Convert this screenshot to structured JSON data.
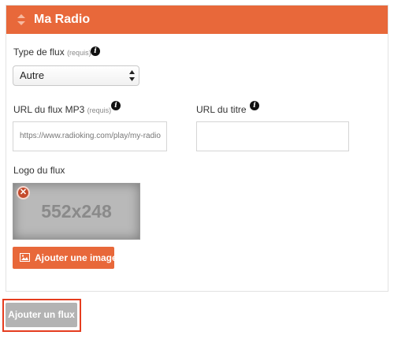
{
  "panel": {
    "title": "Ma Radio",
    "header_color": "#e8683a"
  },
  "stream_type": {
    "label": "Type de flux",
    "required": "(requis)",
    "selected": "Autre"
  },
  "mp3_url": {
    "label": "URL du flux MP3",
    "required": "(requis)",
    "value": "https://www.radioking.com/play/my-radio"
  },
  "title_url": {
    "label": "URL du titre",
    "value": ""
  },
  "logo": {
    "label": "Logo du flux",
    "placeholder_text": "552x248"
  },
  "buttons": {
    "add_image": "Ajouter une image",
    "add_stream": "Ajouter un flux"
  },
  "icons": {
    "header": "sort-icon",
    "info": "info-icon",
    "remove": "remove-icon",
    "image": "image-icon"
  },
  "colors": {
    "accent": "#e8683a",
    "disabled_button": "#b3b3b3",
    "highlight": "#e53d1f"
  }
}
